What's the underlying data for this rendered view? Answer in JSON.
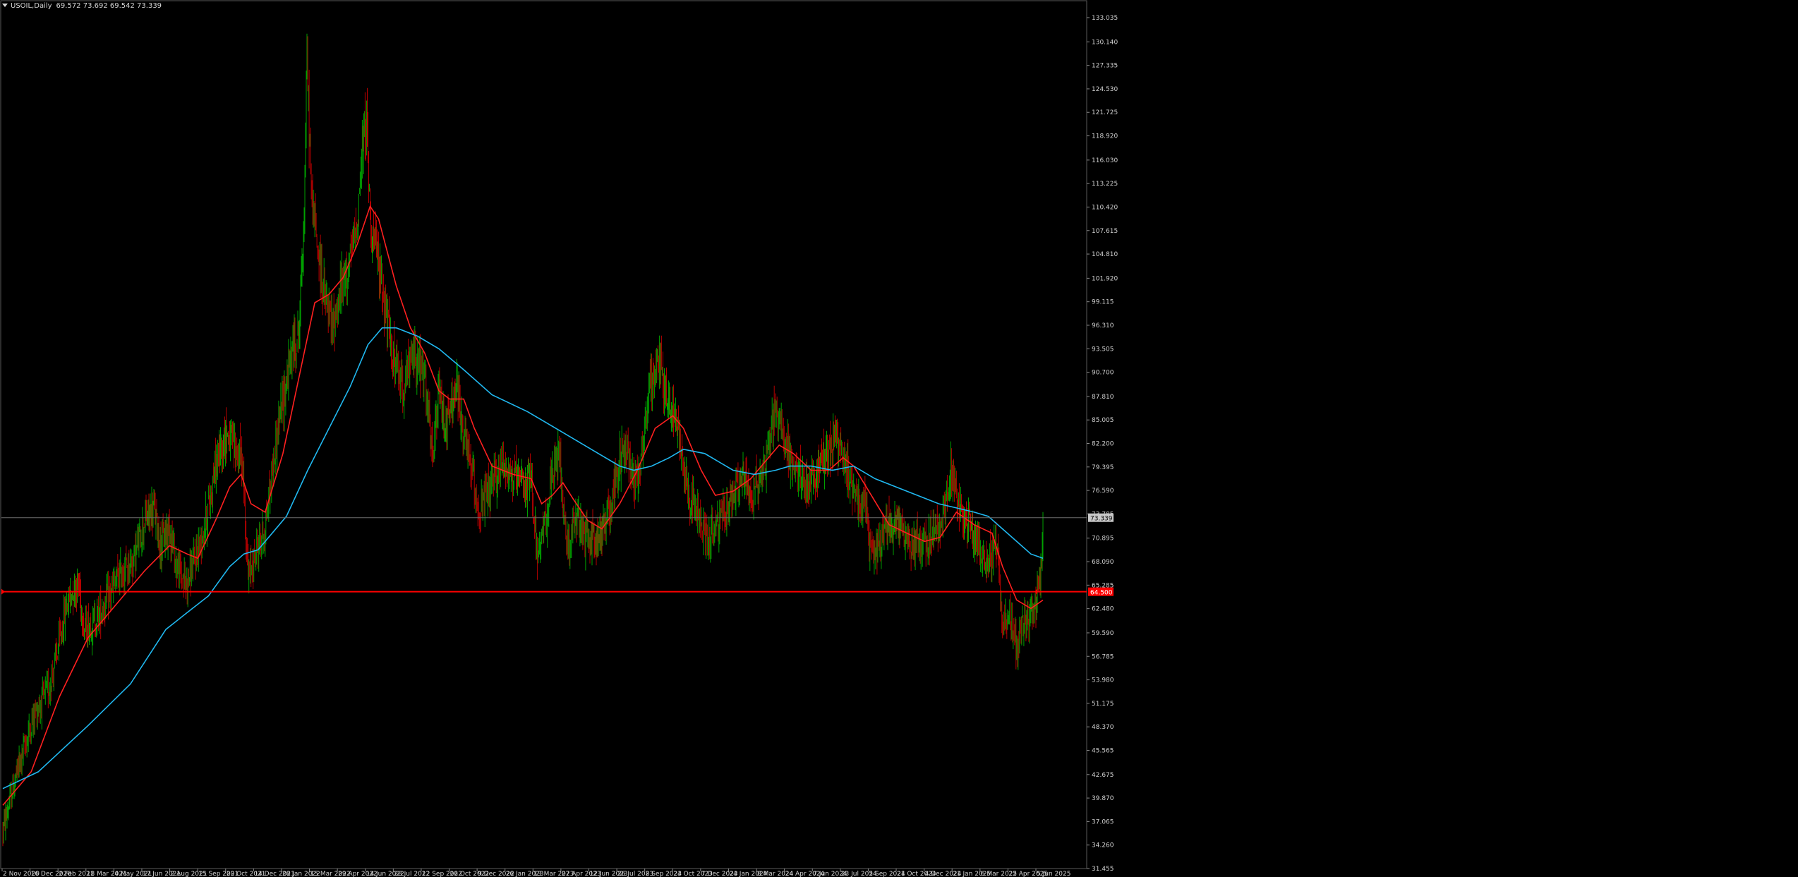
{
  "header": {
    "symbol": "USOIL,Daily",
    "ohlc": "69.572 73.692 69.542 73.339"
  },
  "colors": {
    "background": "#000000",
    "bull_candle": "#00a000",
    "bear_candle": "#b40000",
    "ma_fast": "#ff2020",
    "ma_slow": "#20b8f0",
    "support_line": "#ff0000",
    "price_line": "#6e6e6e",
    "axis_text": "#d0d0d0"
  },
  "chart_data": {
    "type": "candlestick",
    "title": "USOIL,Daily",
    "ylim": [
      31.455,
      134.8
    ],
    "y_tick_labels": [
      "133.035",
      "130.140",
      "127.335",
      "124.530",
      "121.725",
      "118.920",
      "116.030",
      "113.225",
      "110.420",
      "107.615",
      "104.810",
      "101.920",
      "99.115",
      "96.310",
      "93.505",
      "90.700",
      "87.810",
      "85.005",
      "82.200",
      "79.395",
      "76.590",
      "73.785",
      "70.895",
      "68.090",
      "65.285",
      "62.480",
      "59.590",
      "56.785",
      "53.980",
      "51.175",
      "48.370",
      "45.565",
      "42.675",
      "39.870",
      "37.065",
      "34.260",
      "31.455"
    ],
    "x_tick_labels": [
      "2 Nov 2020",
      "16 Dec 2020",
      "2 Feb 2021",
      "18 Mar 2021",
      "4 May 2021",
      "17 Jun 2021",
      "2 Aug 2021",
      "15 Sep 2021",
      "29 Oct 2021",
      "14 Dec 2021",
      "28 Jan 2022",
      "15 Mar 2022",
      "29 Apr 2022",
      "14 Jun 2022",
      "28 Jul 2022",
      "12 Sep 2022",
      "26 Oct 2022",
      "9 Dec 2022",
      "26 Jan 2023",
      "13 Mar 2023",
      "27 Apr 2023",
      "12 Jun 2023",
      "26 Jul 2023",
      "8 Sep 2023",
      "24 Oct 2023",
      "7 Dec 2023",
      "24 Jan 2024",
      "8 Mar 2024",
      "24 Apr 2024",
      "7 Jun 2024",
      "23 Jul 2024",
      "5 Sep 2024",
      "21 Oct 2024",
      "4 Dec 2024",
      "21 Jan 2025",
      "6 Mar 2025",
      "22 Apr 2025",
      "5 Jun 2025"
    ],
    "price_path": [
      [
        0,
        36.0
      ],
      [
        20,
        43.0
      ],
      [
        45,
        50.0
      ],
      [
        65,
        53.0
      ],
      [
        80,
        58.5
      ],
      [
        90,
        63.0
      ],
      [
        100,
        65.0
      ],
      [
        107,
        65.5
      ],
      [
        115,
        60.0
      ],
      [
        130,
        61.0
      ],
      [
        150,
        64.0
      ],
      [
        165,
        66.5
      ],
      [
        185,
        68.5
      ],
      [
        200,
        73.0
      ],
      [
        213,
        74.5
      ],
      [
        223,
        70.0
      ],
      [
        235,
        72.5
      ],
      [
        245,
        67.5
      ],
      [
        258,
        65.5
      ],
      [
        270,
        68.0
      ],
      [
        285,
        72.5
      ],
      [
        300,
        79.5
      ],
      [
        315,
        83.5
      ],
      [
        325,
        82.0
      ],
      [
        338,
        80.0
      ],
      [
        346,
        66.0
      ],
      [
        360,
        70.0
      ],
      [
        370,
        72.0
      ],
      [
        380,
        79.0
      ],
      [
        390,
        85.0
      ],
      [
        405,
        92.0
      ],
      [
        418,
        96.0
      ],
      [
        425,
        110.0
      ],
      [
        429,
        128.0
      ],
      [
        435,
        112.0
      ],
      [
        445,
        105.0
      ],
      [
        455,
        99.0
      ],
      [
        465,
        96.0
      ],
      [
        475,
        100.0
      ],
      [
        490,
        104.0
      ],
      [
        500,
        109.0
      ],
      [
        508,
        118.0
      ],
      [
        513,
        121.0
      ],
      [
        518,
        109.0
      ],
      [
        525,
        106.0
      ],
      [
        535,
        101.0
      ],
      [
        545,
        95.0
      ],
      [
        555,
        91.0
      ],
      [
        565,
        89.0
      ],
      [
        580,
        93.0
      ],
      [
        595,
        90.0
      ],
      [
        606,
        80.0
      ],
      [
        615,
        88.0
      ],
      [
        625,
        84.0
      ],
      [
        640,
        89.0
      ],
      [
        650,
        83.0
      ],
      [
        660,
        79.5
      ],
      [
        672,
        74.0
      ],
      [
        690,
        77.0
      ],
      [
        705,
        80.0
      ],
      [
        720,
        78.0
      ],
      [
        735,
        77.0
      ],
      [
        745,
        78.0
      ],
      [
        755,
        68.0
      ],
      [
        765,
        73.0
      ],
      [
        775,
        78.0
      ],
      [
        785,
        81.0
      ],
      [
        795,
        70.0
      ],
      [
        810,
        73.0
      ],
      [
        820,
        71.0
      ],
      [
        830,
        71.0
      ],
      [
        840,
        70.5
      ],
      [
        850,
        73.0
      ],
      [
        860,
        76.0
      ],
      [
        870,
        80.0
      ],
      [
        880,
        82.0
      ],
      [
        890,
        78.0
      ],
      [
        900,
        80.0
      ],
      [
        910,
        88.0
      ],
      [
        920,
        91.0
      ],
      [
        925,
        93.0
      ],
      [
        935,
        88.0
      ],
      [
        945,
        86.0
      ],
      [
        955,
        83.0
      ],
      [
        965,
        77.0
      ],
      [
        975,
        75.0
      ],
      [
        985,
        72.0
      ],
      [
        995,
        71.0
      ],
      [
        1010,
        72.5
      ],
      [
        1025,
        75.0
      ],
      [
        1035,
        77.0
      ],
      [
        1045,
        78.0
      ],
      [
        1055,
        76.0
      ],
      [
        1065,
        77.5
      ],
      [
        1075,
        80.0
      ],
      [
        1085,
        84.5
      ],
      [
        1095,
        86.0
      ],
      [
        1105,
        82.0
      ],
      [
        1115,
        79.0
      ],
      [
        1125,
        78.0
      ],
      [
        1140,
        77.0
      ],
      [
        1155,
        80.0
      ],
      [
        1165,
        81.5
      ],
      [
        1175,
        83.0
      ],
      [
        1185,
        80.0
      ],
      [
        1195,
        78.0
      ],
      [
        1205,
        76.0
      ],
      [
        1215,
        75.0
      ],
      [
        1225,
        69.0
      ],
      [
        1235,
        70.0
      ],
      [
        1245,
        72.0
      ],
      [
        1260,
        73.0
      ],
      [
        1270,
        71.5
      ],
      [
        1280,
        70.0
      ],
      [
        1290,
        71.0
      ],
      [
        1300,
        70.0
      ],
      [
        1310,
        71.0
      ],
      [
        1320,
        72.0
      ],
      [
        1330,
        75.0
      ],
      [
        1337,
        79.0
      ],
      [
        1345,
        76.0
      ],
      [
        1355,
        73.0
      ],
      [
        1365,
        72.0
      ],
      [
        1375,
        71.0
      ],
      [
        1385,
        68.0
      ],
      [
        1395,
        69.0
      ],
      [
        1403,
        70.0
      ],
      [
        1410,
        60.0
      ],
      [
        1420,
        62.0
      ],
      [
        1430,
        57.5
      ],
      [
        1440,
        61.0
      ],
      [
        1450,
        62.0
      ],
      [
        1458,
        63.0
      ],
      [
        1465,
        68.0
      ],
      [
        1467,
        73.3
      ]
    ],
    "series": [
      {
        "name": "",
        "color": "#ff2020",
        "values": [
          [
            0,
            39.0
          ],
          [
            40,
            43.0
          ],
          [
            80,
            52.0
          ],
          [
            120,
            59.0
          ],
          [
            160,
            63.0
          ],
          [
            200,
            67.0
          ],
          [
            235,
            70.0
          ],
          [
            260,
            69.0
          ],
          [
            275,
            68.5
          ],
          [
            300,
            73.0
          ],
          [
            320,
            77.0
          ],
          [
            336,
            78.5
          ],
          [
            350,
            75.0
          ],
          [
            370,
            74.0
          ],
          [
            395,
            81.0
          ],
          [
            420,
            91.0
          ],
          [
            440,
            99.0
          ],
          [
            460,
            100.0
          ],
          [
            480,
            102.0
          ],
          [
            500,
            106.0
          ],
          [
            518,
            110.5
          ],
          [
            530,
            109.0
          ],
          [
            555,
            101.0
          ],
          [
            575,
            96.0
          ],
          [
            595,
            93.0
          ],
          [
            615,
            88.5
          ],
          [
            630,
            87.5
          ],
          [
            650,
            87.5
          ],
          [
            665,
            84.0
          ],
          [
            690,
            79.5
          ],
          [
            720,
            78.5
          ],
          [
            745,
            78.0
          ],
          [
            760,
            75.0
          ],
          [
            775,
            76.0
          ],
          [
            790,
            77.5
          ],
          [
            805,
            75.5
          ],
          [
            825,
            73.0
          ],
          [
            845,
            72.0
          ],
          [
            870,
            75.0
          ],
          [
            895,
            79.0
          ],
          [
            920,
            84.0
          ],
          [
            945,
            85.5
          ],
          [
            960,
            84.0
          ],
          [
            985,
            79.0
          ],
          [
            1005,
            76.0
          ],
          [
            1030,
            76.5
          ],
          [
            1055,
            78.0
          ],
          [
            1075,
            80.0
          ],
          [
            1095,
            82.0
          ],
          [
            1115,
            81.0
          ],
          [
            1140,
            79.0
          ],
          [
            1165,
            79.0
          ],
          [
            1185,
            80.5
          ],
          [
            1200,
            79.5
          ],
          [
            1225,
            76.0
          ],
          [
            1250,
            72.5
          ],
          [
            1275,
            71.5
          ],
          [
            1300,
            70.5
          ],
          [
            1322,
            71.0
          ],
          [
            1345,
            74.0
          ],
          [
            1370,
            72.5
          ],
          [
            1395,
            71.5
          ],
          [
            1410,
            67.5
          ],
          [
            1430,
            63.5
          ],
          [
            1450,
            62.5
          ],
          [
            1467,
            63.5
          ]
        ]
      },
      {
        "name": "",
        "color": "#20b8f0",
        "values": [
          [
            0,
            41.0
          ],
          [
            50,
            43.0
          ],
          [
            120,
            48.5
          ],
          [
            180,
            53.5
          ],
          [
            230,
            60.0
          ],
          [
            260,
            62.0
          ],
          [
            290,
            64.0
          ],
          [
            320,
            67.5
          ],
          [
            340,
            69.0
          ],
          [
            360,
            69.5
          ],
          [
            400,
            73.5
          ],
          [
            430,
            79.0
          ],
          [
            460,
            84.0
          ],
          [
            490,
            89.0
          ],
          [
            515,
            94.0
          ],
          [
            535,
            96.0
          ],
          [
            555,
            96.0
          ],
          [
            585,
            95.0
          ],
          [
            615,
            93.5
          ],
          [
            650,
            91.0
          ],
          [
            690,
            88.0
          ],
          [
            740,
            86.0
          ],
          [
            790,
            83.5
          ],
          [
            840,
            81.0
          ],
          [
            870,
            79.5
          ],
          [
            890,
            79.0
          ],
          [
            915,
            79.5
          ],
          [
            940,
            80.5
          ],
          [
            960,
            81.5
          ],
          [
            990,
            81.0
          ],
          [
            1030,
            79.0
          ],
          [
            1060,
            78.5
          ],
          [
            1090,
            79.0
          ],
          [
            1110,
            79.5
          ],
          [
            1140,
            79.5
          ],
          [
            1170,
            79.0
          ],
          [
            1200,
            79.5
          ],
          [
            1230,
            78.0
          ],
          [
            1260,
            77.0
          ],
          [
            1290,
            76.0
          ],
          [
            1320,
            75.0
          ],
          [
            1345,
            74.5
          ],
          [
            1370,
            74.0
          ],
          [
            1390,
            73.5
          ],
          [
            1410,
            72.0
          ],
          [
            1430,
            70.5
          ],
          [
            1450,
            69.0
          ],
          [
            1467,
            68.5
          ]
        ]
      }
    ],
    "support_level": 64.5,
    "last_price": 73.339,
    "last_price_label": "73.339",
    "support_label": "64.500",
    "grid": false,
    "legend": "none"
  }
}
